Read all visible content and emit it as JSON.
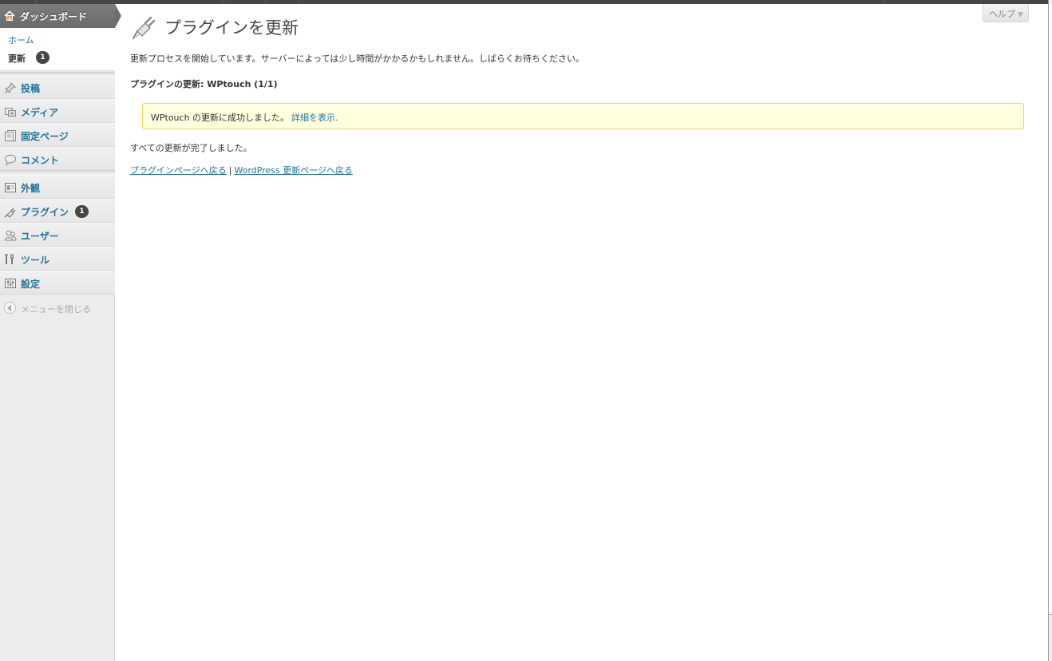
{
  "sidebar": {
    "dashboard_label": "ダッシュボード",
    "submenu": {
      "home_label": "ホーム",
      "update_label": "更新",
      "update_count": "1"
    },
    "items": [
      {
        "label": "投稿",
        "icon": "pin-icon"
      },
      {
        "label": "メディア",
        "icon": "media-icon"
      },
      {
        "label": "固定ページ",
        "icon": "pages-icon"
      },
      {
        "label": "コメント",
        "icon": "comment-icon"
      },
      {
        "label": "外観",
        "icon": "appearance-icon"
      },
      {
        "label": "プラグイン",
        "icon": "plugin-icon",
        "count": "1"
      },
      {
        "label": "ユーザー",
        "icon": "users-icon"
      },
      {
        "label": "ツール",
        "icon": "tools-icon"
      },
      {
        "label": "設定",
        "icon": "settings-icon"
      }
    ],
    "collapse_label": "メニューを閉じる"
  },
  "help_tab": {
    "label": "ヘルプ",
    "arrow": "▼"
  },
  "main": {
    "title": "プラグインを更新",
    "intro": "更新プロセスを開始しています。サーバーによっては少し時間がかかるかもしれません。しばらくお待ちください。",
    "plugin_heading": "プラグインの更新: WPtouch (1/1)",
    "notice_text": "WPtouch の更新に成功しました。",
    "notice_link": "詳細を表示.",
    "complete_text": "すべての更新が完了しました。",
    "link_plugins": "プラグインページへ戻る",
    "link_separator": "|",
    "link_updates": "WordPress 更新ページへ戻る"
  },
  "colors": {
    "link": "#21759b",
    "notice_bg": "#ffffe0",
    "notice_border": "#e6db55",
    "sidebar_bg": "#ececec",
    "dashboard_bg": "#707070"
  }
}
